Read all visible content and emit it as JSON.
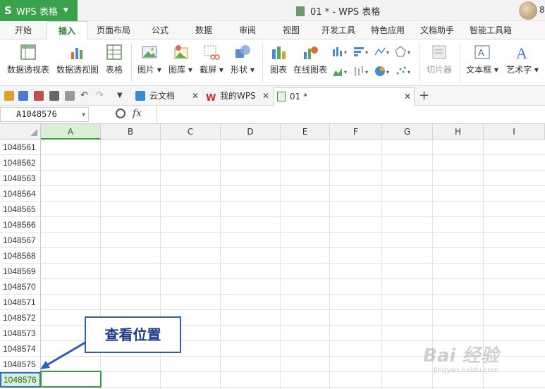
{
  "app": {
    "name": "WPS 表格",
    "logo": "S"
  },
  "window": {
    "title": "01 * - WPS 表格",
    "avatar_num": "8"
  },
  "ribbon_tabs": [
    "开始",
    "插入",
    "页面布局",
    "公式",
    "数据",
    "审阅",
    "视图",
    "开发工具",
    "特色应用",
    "文档助手",
    "智能工具箱"
  ],
  "active_tab": "插入",
  "ribbon": {
    "pivot_table": "数据透视表",
    "pivot_chart": "数据透视图",
    "table": "表格",
    "picture": "图片",
    "gallery": "图库",
    "screenshot": "截屏",
    "shapes": "形状",
    "chart": "图表",
    "online_chart": "在线图表",
    "slicer": "切片器",
    "textbox": "文本框",
    "wordart": "艺术字"
  },
  "doc_tabs": [
    {
      "label": "云文档"
    },
    {
      "label": "我的WPS"
    },
    {
      "label": "01 *"
    }
  ],
  "formula_bar": {
    "name_box": "A1048576",
    "fx": "fx"
  },
  "columns": [
    "A",
    "B",
    "C",
    "D",
    "E",
    "F",
    "G",
    "H",
    "I"
  ],
  "rows": [
    "1048561",
    "1048562",
    "1048563",
    "1048564",
    "1048565",
    "1048566",
    "1048567",
    "1048568",
    "1048569",
    "1048570",
    "1048571",
    "1048572",
    "1048573",
    "1048574",
    "1048575",
    "1048576"
  ],
  "annotation": {
    "text": "查看位置"
  },
  "watermark": {
    "text": "Bai 经验",
    "sub": "jingyan.baidu.com"
  },
  "colors": {
    "accent": "#3aa24a",
    "select_blue": "#2b6fce",
    "callout_border": "#2b5fb8"
  }
}
